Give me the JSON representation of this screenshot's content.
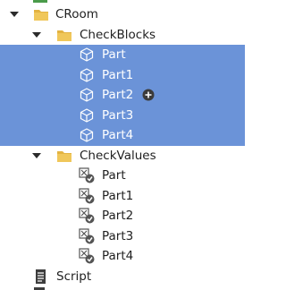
{
  "tree": {
    "croom": {
      "label": "CRoom",
      "icon": "folder-icon"
    },
    "checkblocks": {
      "label": "CheckBlocks",
      "icon": "folder-icon",
      "items": [
        {
          "label": "Part",
          "icon": "part-cube-icon"
        },
        {
          "label": "Part1",
          "icon": "part-cube-icon"
        },
        {
          "label": "Part2",
          "icon": "part-cube-icon"
        },
        {
          "label": "Part3",
          "icon": "part-cube-icon"
        },
        {
          "label": "Part4",
          "icon": "part-cube-icon"
        }
      ]
    },
    "checkvalues": {
      "label": "CheckValues",
      "icon": "folder-icon",
      "items": [
        {
          "label": "Part",
          "icon": "bool-value-icon"
        },
        {
          "label": "Part1",
          "icon": "bool-value-icon"
        },
        {
          "label": "Part2",
          "icon": "bool-value-icon"
        },
        {
          "label": "Part3",
          "icon": "bool-value-icon"
        },
        {
          "label": "Part4",
          "icon": "bool-value-icon"
        }
      ]
    },
    "script": {
      "label": "Script",
      "icon": "script-icon"
    }
  },
  "colors": {
    "selection": "#6b93d8",
    "folder": "#e3b341"
  }
}
